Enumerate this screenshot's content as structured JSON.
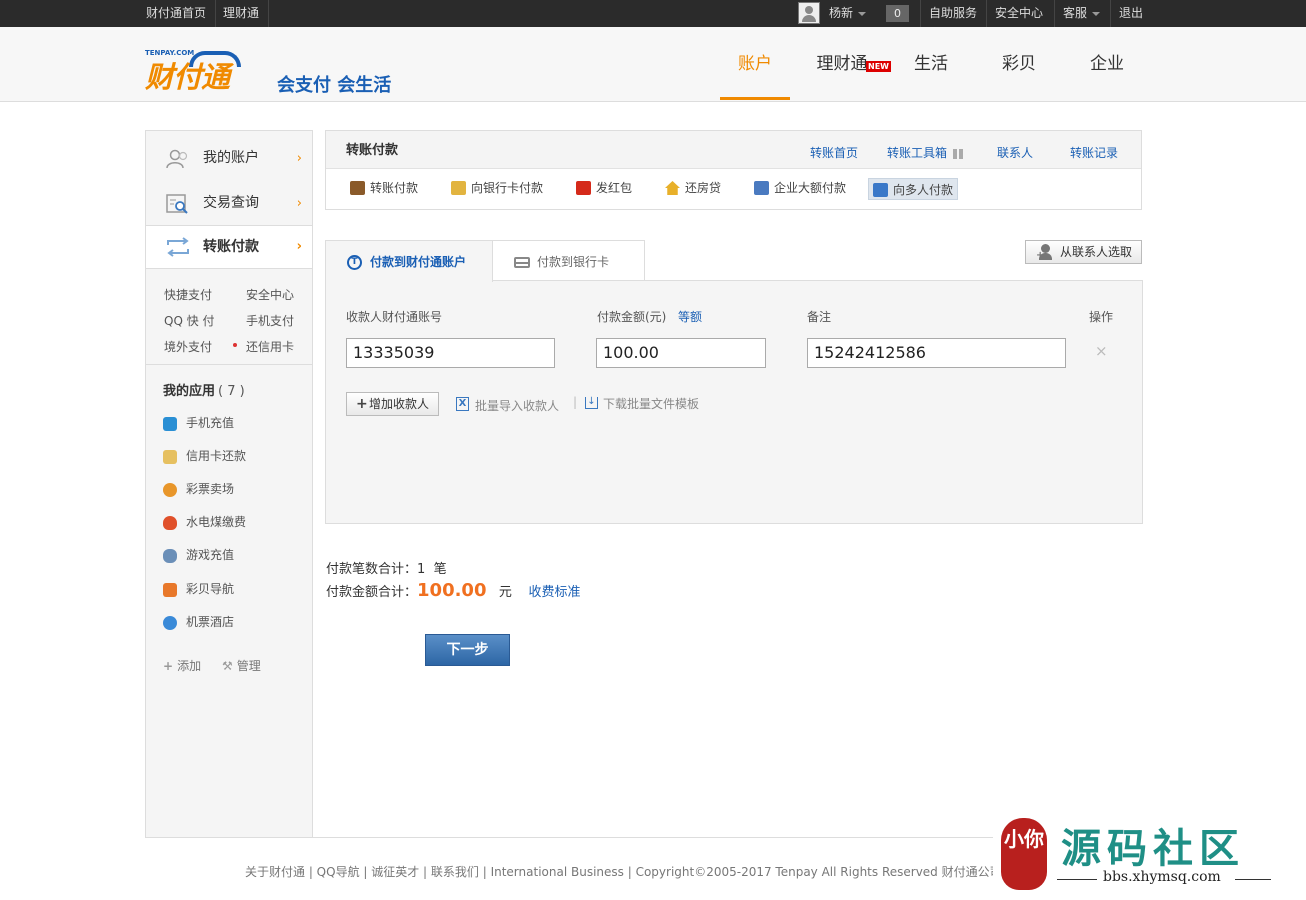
{
  "topbar": {
    "links": [
      "财付通首页",
      "理财通"
    ],
    "user_name": "杨新",
    "msg_count": "0",
    "self_service": "自助服务",
    "security": "安全中心",
    "customer_service": "客服",
    "logout": "退出"
  },
  "header": {
    "logo_small": "TENPAY.COM",
    "logo_big": "财付通",
    "slogan": "会支付 会生活",
    "nav": [
      "账户",
      "理财通",
      "生活",
      "彩贝",
      "企业"
    ],
    "new_badge": "NEW"
  },
  "sidebar": {
    "items": [
      {
        "label": "我的账户",
        "arrow": "›"
      },
      {
        "label": "交易查询",
        "arrow": "›"
      },
      {
        "label": "转账付款",
        "arrow": "›"
      }
    ],
    "links": [
      "快捷支付",
      "安全中心",
      "QQ 快 付",
      "手机支付",
      "境外支付",
      "还信用卡"
    ],
    "apps_title": "我的应用",
    "apps_count": "( 7 )",
    "apps": [
      "手机充值",
      "信用卡还款",
      "彩票卖场",
      "水电煤缴费",
      "游戏充值",
      "彩贝导航",
      "机票酒店"
    ],
    "add": "添加",
    "manage": "管理"
  },
  "panel": {
    "title": "转账付款",
    "header_links": [
      "转账首页",
      "转账工具箱",
      "联系人",
      "转账记录"
    ],
    "tools": [
      "转账付款",
      "向银行卡付款",
      "发红包",
      "还房贷",
      "企业大额付款",
      "向多人付款"
    ]
  },
  "tabs": {
    "tab1": "付款到财付通账户",
    "tab2": "付款到银行卡",
    "contact_btn": "从联系人选取"
  },
  "form": {
    "col_account": "收款人财付通账号",
    "col_amount": "付款金额(元)",
    "equal_amount": "等额",
    "col_note": "备注",
    "col_action": "操作",
    "account_value": "13335039",
    "amount_value": "100.00",
    "note_value": "15242412586",
    "delete": "×",
    "add_payee": "增加收款人",
    "batch_import": "批量导入收款人",
    "download_template": "下载批量文件模板"
  },
  "summary": {
    "count_label": "付款笔数合计：",
    "count_value": "1",
    "count_unit": "笔",
    "amount_label": "付款金额合计：",
    "amount_value": "100.00",
    "amount_unit": "元",
    "fee_link": "收费标准"
  },
  "next_button": "下一步",
  "footer": "关于财付通  |  QQ导航  |  诚征英才  |  联系我们  |  International Business  |  Copyright©2005-2017 Tenpay All Rights Reserved 财付通公司",
  "watermark": {
    "title": "源码社区",
    "url": "bbs.xhymsq.com",
    "seal_text": "小你"
  }
}
